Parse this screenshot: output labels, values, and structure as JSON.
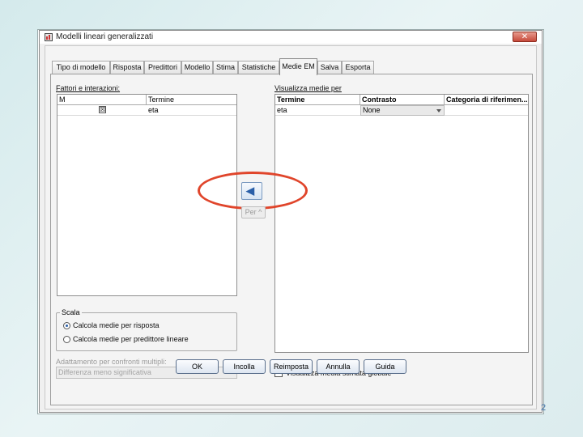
{
  "window": {
    "title": "Modelli lineari generalizzati",
    "close_glyph": "✕"
  },
  "tabs": [
    {
      "label": "Tipo di modello",
      "active": false
    },
    {
      "label": "Risposta",
      "active": false
    },
    {
      "label": "Predittori",
      "active": false
    },
    {
      "label": "Modello",
      "active": false
    },
    {
      "label": "Stima",
      "active": false
    },
    {
      "label": "Statistiche",
      "active": false
    },
    {
      "label": "Medie EM",
      "active": true
    },
    {
      "label": "Salva",
      "active": false
    },
    {
      "label": "Esporta",
      "active": false
    }
  ],
  "factors": {
    "label": "Fattori e interazioni:",
    "col_m": "M",
    "col_term": "Termine",
    "rows": [
      {
        "checked": "☒",
        "term": "eta"
      }
    ]
  },
  "display_means": {
    "label": "Visualizza medie per",
    "col_term": "Termine",
    "col_contrast": "Contrasto",
    "col_ref": "Categoria di riferimen...",
    "rows": [
      {
        "term": "eta",
        "contrast": "None",
        "ref": ""
      }
    ]
  },
  "move_button": {
    "icon": "arrow-left-icon",
    "glyph": "◀"
  },
  "by_button": {
    "label": "Per ^"
  },
  "scale": {
    "legend": "Scala",
    "options": [
      {
        "label": "Calcola medie per risposta",
        "selected": true
      },
      {
        "label": "Calcola medie per predittore lineare",
        "selected": false
      }
    ]
  },
  "adjustment": {
    "label": "Adattamento per confronti multipli:",
    "value": "Differenza meno significativa"
  },
  "global_mean": {
    "label": "Visualizza media stimata globale",
    "checked": false
  },
  "buttons": {
    "ok": "OK",
    "paste": "Incolla",
    "reset": "Reimposta",
    "cancel": "Annulla",
    "help": "Guida"
  },
  "page_number": "2",
  "colors": {
    "highlight": "#e0452b",
    "accent": "#2a5fa8"
  }
}
